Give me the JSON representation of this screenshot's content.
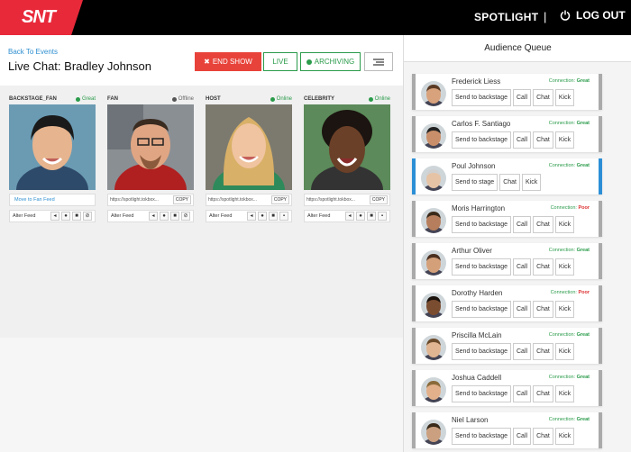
{
  "app": {
    "logo": "SNT",
    "title": "SPOTLIGHT",
    "separator": "|",
    "logout_label": "LOG OUT"
  },
  "header": {
    "back_link": "Back To Events",
    "title": "Live Chat: Bradley Johnson",
    "end_show_label": "END SHOW",
    "live_label": "LIVE",
    "archiving_label": "ARCHIVING"
  },
  "cards": [
    {
      "role": "BACKSTAGE_FAN",
      "status": "Great",
      "status_color": "#2a9b4a",
      "move_label": "Move to Fan Feed",
      "alter_label": "Alter Feed"
    },
    {
      "role": "FAN",
      "status": "Offline",
      "status_color": "#777777",
      "url": "https://spotlight.tokbox...",
      "copy_label": "COPY",
      "alter_label": "Alter Feed"
    },
    {
      "role": "HOST",
      "status": "Online",
      "status_color": "#2a9b4a",
      "url": "https://spotlight.tokbox...",
      "copy_label": "COPY",
      "alter_label": "Alter Feed"
    },
    {
      "role": "CELEBRITY",
      "status": "Online",
      "status_color": "#2a9b4a",
      "url": "https://spotlight.tokbox...",
      "copy_label": "COPY",
      "alter_label": "Alter Feed"
    }
  ],
  "queue": {
    "title": "Audience Queue",
    "connection_label": "Connection:",
    "items": [
      {
        "name": "Frederick Liess",
        "quality": "Great",
        "actions": [
          "Send to backstage",
          "Call",
          "Chat",
          "Kick"
        ]
      },
      {
        "name": "Carlos F. Santiago",
        "quality": "Great",
        "actions": [
          "Send to backstage",
          "Call",
          "Chat",
          "Kick"
        ]
      },
      {
        "name": "Poul Johnson",
        "quality": "Great",
        "actions": [
          "Send to stage",
          "Chat",
          "Kick"
        ]
      },
      {
        "name": "Moris Harrington",
        "quality": "Poor",
        "actions": [
          "Send to backstage",
          "Call",
          "Chat",
          "Kick"
        ]
      },
      {
        "name": "Arthur Oliver",
        "quality": "Great",
        "actions": [
          "Send to backstage",
          "Call",
          "Chat",
          "Kick"
        ]
      },
      {
        "name": "Dorothy Harden",
        "quality": "Poor",
        "actions": [
          "Send to backstage",
          "Call",
          "Chat",
          "Kick"
        ]
      },
      {
        "name": "Priscilla McLain",
        "quality": "Great",
        "actions": [
          "Send to backstage",
          "Call",
          "Chat",
          "Kick"
        ]
      },
      {
        "name": "Joshua Caddell",
        "quality": "Great",
        "actions": [
          "Send to backstage",
          "Call",
          "Chat",
          "Kick"
        ]
      },
      {
        "name": "Niel Larson",
        "quality": "Great",
        "actions": [
          "Send to backstage",
          "Call",
          "Chat",
          "Kick"
        ]
      }
    ]
  },
  "colors": {
    "brand": "#e8293a",
    "great": "#2a9b4a",
    "poor": "#dd3333",
    "active": "#2c8fd6"
  }
}
